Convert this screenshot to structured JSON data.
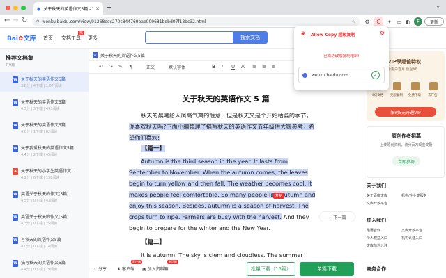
{
  "browser": {
    "tab_title": "关于秋天的英语作文5篇 - 百度文库",
    "url": "wenku.baidu.com/view/91268eec270c844769eae009681bdbd07f18bc32.html",
    "update_label": "更新",
    "avatar_letter": "F"
  },
  "site": {
    "logo_text": "Bai",
    "logo_text2": "文库",
    "nav": [
      "首页",
      "文档工具",
      "更多"
    ],
    "hot_badge": "热",
    "search_button": "搜索文档"
  },
  "sidebar": {
    "title": "推荐文档集",
    "count": "共9篇",
    "items": [
      {
        "icon": "W",
        "title": "关于秋天的英语作文5篇",
        "meta": "3.8分  |  4下载  |  1.0万阅读",
        "active": true,
        "type": "word"
      },
      {
        "icon": "W",
        "title": "关于秋天的英语作文5篇",
        "meta": "4.5分  |  3下载  |  493阅读",
        "type": "word"
      },
      {
        "icon": "W",
        "title": "关于秋天的英语作文5篇",
        "meta": "4.0分  |  1下载  |  82阅读",
        "type": "word"
      },
      {
        "icon": "W",
        "title": "关于我爱秋天的英语作文5篇",
        "meta": "4.4分  |  2下载  |  45阅读",
        "type": "word"
      },
      {
        "icon": "A",
        "title": "关于秋天的小学生英语作文...",
        "meta": "4.2分  |  6下载  |  138阅读",
        "type": "pdf"
      },
      {
        "icon": "W",
        "title": "英语关于秋天的作文(5篇)",
        "meta": "4.5分  |  0下载  |  43阅读",
        "type": "word"
      },
      {
        "icon": "W",
        "title": "英语关于秋天的作文(5篇)",
        "meta": "4.3分  |  0下载  |  25阅读",
        "type": "word"
      },
      {
        "icon": "W",
        "title": "写秋天的英语作文5篇",
        "meta": "4.0分  |  0下载  |  14阅读",
        "type": "word"
      },
      {
        "icon": "W",
        "title": "描写秋天的英语作文5篇",
        "meta": "4.4分  |  0下载  |  19阅读",
        "type": "word"
      }
    ]
  },
  "doc": {
    "file_title": "关于秋天的英语作文5篇",
    "toolbar": [
      "↶",
      "↷",
      "✎",
      "¶",
      "正文",
      "默认字体",
      "",
      "B",
      "I",
      "U",
      "A",
      "≡",
      "≡",
      "≡"
    ],
    "heading": "关于秋天的英语作文 5 篇",
    "intro_1": "秋天的晨曦给人凤高气爽的惬意，但是秋天又是个开始枯萎的季节，",
    "intro_2": "你喜欢秋天吗?下面小编整理了描写秋天的英语作文五年级供大家参考，希望你们喜欢!",
    "section1": "【篇一】",
    "para1_hl": "Autumn is the third season in the year. It lasts from September to November. When the autumn comes, the leaves begin to turn yellow and then fall. The weather becomes cool. It makes people feel comfortable. So many people like autumn and enjoy this season. Besides, autumn is a season of harvest. The crops turn to ripe. Farmers are busy with the harvest.",
    "para1_rest": " And they begin to prepare for the winter and the New Year.",
    "section2": "【篇二】",
    "para2": "It is autumn. The sky is clem and cloudless. The summer heat",
    "copy_badge": "复制",
    "next_label": "下一篇"
  },
  "bottombar": {
    "share": "分享",
    "client": "客户端",
    "client_tag": "客户端",
    "add_lib": "加入资料箱",
    "add_tag": "新功能",
    "batch": "批量下载（15篇）",
    "single": "单篇下载"
  },
  "right": {
    "vip_title": "VIP享超值特权",
    "vip_sub": "新用户首月 低至¥6",
    "vip_features": [
      "6亿文档",
      "无限复制",
      "免费下载",
      "去广告"
    ],
    "vip_button": "限时5元开通VIP",
    "author_title": "原创作者招募",
    "author_sub": "上传原创资料，流分百万现金奖励",
    "author_button": "立即参与",
    "about_title": "关于我们",
    "about_links": [
      "关于百度文库",
      "机构/企业类服务",
      "文库开放平台",
      ""
    ],
    "join_title": "加入我们",
    "join_links": [
      "最惠合作",
      "文库开放平台",
      "个人权益入口",
      "机构认证入口",
      "文库前途入驻",
      ""
    ],
    "service_title": "商务合作"
  },
  "popup": {
    "title": "Allow Copy 超级复制",
    "message": "已成功破解复制限制!",
    "site": "wenku.baidu.com",
    "check": "✓"
  }
}
